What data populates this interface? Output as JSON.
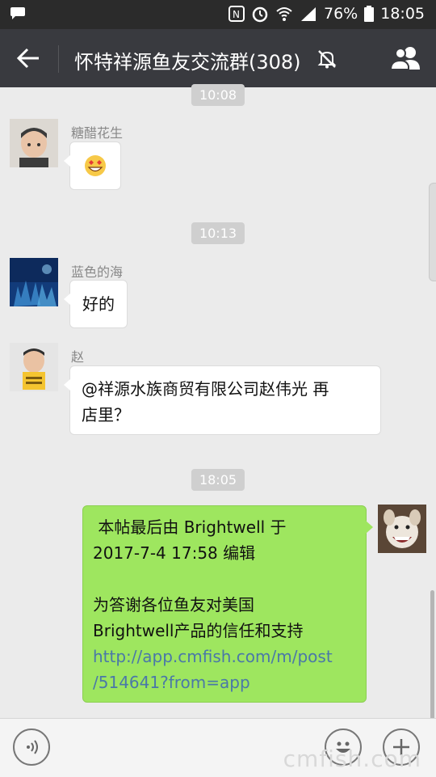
{
  "status_bar": {
    "battery": "76%",
    "time": "18:05",
    "icons": [
      "message-icon",
      "nfc-icon",
      "alarm-icon",
      "wifi-icon",
      "signal-icon",
      "battery-icon"
    ]
  },
  "header": {
    "title": "怀特祥源鱼友交流群(308)",
    "icons": [
      "back-arrow-icon",
      "mute-bell-icon",
      "group-members-icon"
    ]
  },
  "messages": [
    {
      "type": "timestamp",
      "text": "10:08"
    },
    {
      "type": "incoming",
      "sender": "糖醋花生",
      "content": "emoji-grin-icon"
    },
    {
      "type": "timestamp",
      "text": "10:13"
    },
    {
      "type": "incoming",
      "sender": "蓝色的海",
      "content": "好的"
    },
    {
      "type": "incoming",
      "sender": "赵",
      "content_lines": [
        "@祥源水族商贸有限公司赵伟光 再",
        "店里？"
      ]
    },
    {
      "type": "timestamp",
      "text": "18:05"
    },
    {
      "type": "outgoing",
      "lines": [
        " 本帖最后由 Brightwell 于",
        "2017-7-4 17:58 编辑",
        "",
        "为答谢各位鱼友对美国",
        "Brightwell产品的信任和支持"
      ],
      "link_lines": [
        "http://app.cmfish.com/m/post",
        "/514641?from=app"
      ]
    }
  ],
  "input_bar": {
    "icons": [
      "voice-icon",
      "emoji-icon",
      "plus-icon"
    ]
  },
  "watermark": "cmfish.com",
  "colors": {
    "title_bar": "#393a3f",
    "status_bar": "#2b2b2b",
    "chat_bg": "#ebebeb",
    "outgoing_bubble": "#9ee65f",
    "link": "#4a78a8"
  }
}
